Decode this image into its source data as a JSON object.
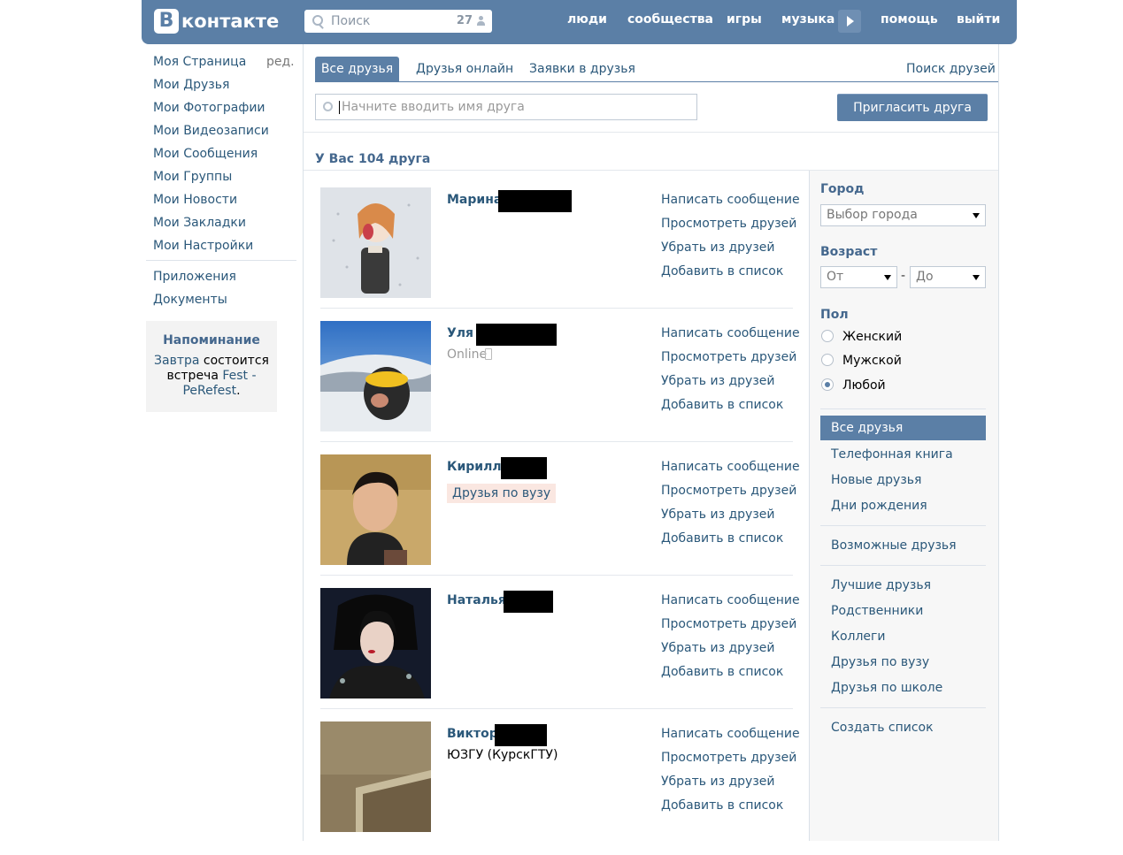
{
  "header": {
    "logo_letter": "В",
    "logo_text": "контакте",
    "search_placeholder": "Поиск",
    "search_count": "27",
    "nav": [
      "люди",
      "сообщества",
      "игры",
      "музыка",
      "помощь",
      "выйти"
    ]
  },
  "left_menu": {
    "items": [
      "Моя Страница",
      "Мои Друзья",
      "Мои Фотографии",
      "Мои Видеозаписи",
      "Мои Сообщения",
      "Мои Группы",
      "Мои Новости",
      "Мои Закладки",
      "Мои Настройки"
    ],
    "edit_label": "ред.",
    "extra_items": [
      "Приложения",
      "Документы"
    ],
    "reminder": {
      "title": "Напоминание",
      "text_pre": "Завтра",
      "text_mid": " состоится встреча ",
      "link": "Fest - PeRefest",
      "text_end": "."
    }
  },
  "tabs": {
    "active": "Все друзья",
    "items": [
      "Друзья онлайн",
      "Заявки в друзья"
    ],
    "search_friends": "Поиск друзей"
  },
  "friend_search": {
    "placeholder": "Начните вводить имя друга",
    "invite_button": "Пригласить друга"
  },
  "summary": "У Вас 104 друга",
  "friends": [
    {
      "name": "Марина",
      "sub": "",
      "badge": ""
    },
    {
      "name": "Уля",
      "sub": "Online",
      "badge": ""
    },
    {
      "name": "Кирилл",
      "sub": "",
      "badge": "Друзья по вузу"
    },
    {
      "name": "Наталья",
      "sub": "",
      "badge": ""
    },
    {
      "name": "Виктор",
      "sub": "ЮЗГУ (КурскГТУ)",
      "badge": ""
    }
  ],
  "friend_actions": [
    "Написать сообщение",
    "Просмотреть друзей",
    "Убрать из друзей",
    "Добавить в список"
  ],
  "filters": {
    "city_label": "Город",
    "city_select": "Выбор города",
    "age_label": "Возраст",
    "age_from": "От",
    "age_dash": "-",
    "age_to": "До",
    "gender_label": "Пол",
    "genders": [
      "Женский",
      "Мужской",
      "Любой"
    ],
    "selected_gender": "Любой",
    "categories_active": "Все друзья",
    "categories_1": [
      "Телефонная книга",
      "Новые друзья",
      "Дни рождения"
    ],
    "categories_2": [
      "Возможные друзья"
    ],
    "categories_3": [
      "Лучшие друзья",
      "Родственники",
      "Коллеги",
      "Друзья по вузу",
      "Друзья по школе"
    ],
    "create_list": "Создать список"
  }
}
